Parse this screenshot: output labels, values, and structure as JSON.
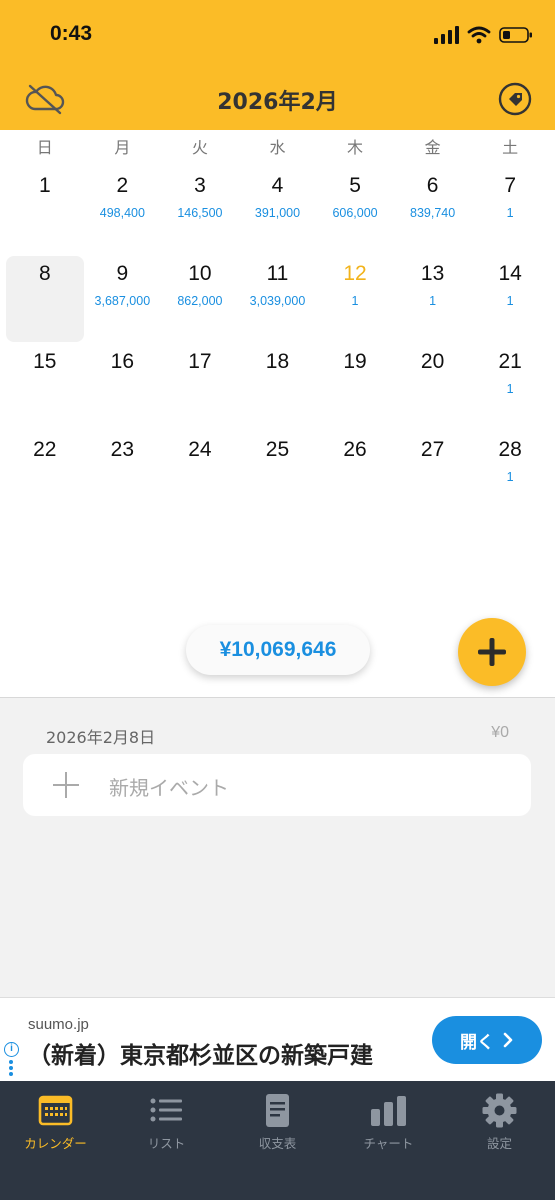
{
  "status": {
    "time": "0:43"
  },
  "header": {
    "title": "2026年2月"
  },
  "weekdays": [
    "日",
    "月",
    "火",
    "水",
    "木",
    "金",
    "土"
  ],
  "calendar": {
    "weeks": [
      [
        {
          "day": "1",
          "amount": ""
        },
        {
          "day": "2",
          "amount": "498,400"
        },
        {
          "day": "3",
          "amount": "146,500"
        },
        {
          "day": "4",
          "amount": "391,000"
        },
        {
          "day": "5",
          "amount": "606,000"
        },
        {
          "day": "6",
          "amount": "839,740"
        },
        {
          "day": "7",
          "amount": "1"
        }
      ],
      [
        {
          "day": "8",
          "amount": "",
          "selected": true
        },
        {
          "day": "9",
          "amount": "3,687,000"
        },
        {
          "day": "10",
          "amount": "862,000"
        },
        {
          "day": "11",
          "amount": "3,039,000"
        },
        {
          "day": "12",
          "amount": "1",
          "today": true
        },
        {
          "day": "13",
          "amount": "1"
        },
        {
          "day": "14",
          "amount": "1"
        }
      ],
      [
        {
          "day": "15",
          "amount": ""
        },
        {
          "day": "16",
          "amount": ""
        },
        {
          "day": "17",
          "amount": ""
        },
        {
          "day": "18",
          "amount": ""
        },
        {
          "day": "19",
          "amount": ""
        },
        {
          "day": "20",
          "amount": ""
        },
        {
          "day": "21",
          "amount": "1"
        }
      ],
      [
        {
          "day": "22",
          "amount": ""
        },
        {
          "day": "23",
          "amount": ""
        },
        {
          "day": "24",
          "amount": ""
        },
        {
          "day": "25",
          "amount": ""
        },
        {
          "day": "26",
          "amount": ""
        },
        {
          "day": "27",
          "amount": ""
        },
        {
          "day": "28",
          "amount": "1"
        }
      ]
    ]
  },
  "summary": {
    "total": "¥10,069,646"
  },
  "selected_day": {
    "date": "2026年2月8日",
    "total": "¥0",
    "new_event_label": "新規イベント"
  },
  "ad": {
    "domain": "suumo.jp",
    "title": "（新着）東京都杉並区の新築戸建",
    "button_label": "開く",
    "info_glyph": "i"
  },
  "tabs": [
    {
      "label": "カレンダー",
      "icon": "calendar-icon",
      "active": true
    },
    {
      "label": "リスト",
      "icon": "list-icon"
    },
    {
      "label": "収支表",
      "icon": "document-icon"
    },
    {
      "label": "チャート",
      "icon": "bar-chart-icon"
    },
    {
      "label": "設定",
      "icon": "gear-icon"
    }
  ],
  "colors": {
    "accent": "#fbbc27",
    "amount_blue": "#1a8fe0",
    "tabbar": "#2d3642",
    "today": "#f2b31b"
  }
}
